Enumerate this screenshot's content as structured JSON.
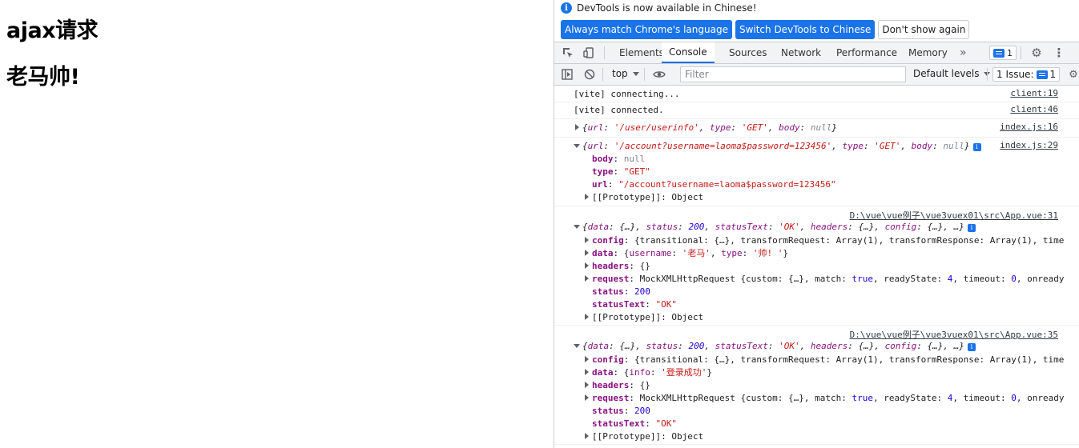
{
  "page": {
    "heading1": "ajax请求",
    "heading2": "老马帅!"
  },
  "devtools": {
    "infobar": {
      "message": "DevTools is now available in Chinese!",
      "buttons": [
        "Always match Chrome's language",
        "Switch DevTools to Chinese",
        "Don't show again"
      ]
    },
    "tabs": [
      "Elements",
      "Console",
      "Sources",
      "Network",
      "Performance",
      "Memory"
    ],
    "active_tab": "Console",
    "more_tabs_glyph": "»",
    "issues_count": "1",
    "toolbar": {
      "context": "top",
      "filter_placeholder": "Filter",
      "levels": "Default levels",
      "issue_label": "1 Issue:",
      "issue_count": "1"
    },
    "colors": {
      "accent": "#1a73e8"
    },
    "icons": [
      "inspect-icon",
      "device-icon",
      "settings-icon",
      "kebab-menu-icon",
      "sidebar-toggle-icon",
      "clear-icon",
      "eye-icon",
      "info-icon"
    ]
  },
  "console": {
    "msg1": {
      "text": "[vite] connecting...",
      "src": "client:19"
    },
    "msg2": {
      "text": "[vite] connected.",
      "src": "client:46"
    },
    "msg3": {
      "src": "index.js:16",
      "url": "'/user/userinfo'",
      "type": "'GET'",
      "body": "null"
    },
    "msg4": {
      "src": "index.js:29",
      "url": "'/account?username=laoma$password=123456'",
      "type": "'GET'",
      "body": "null",
      "props": {
        "body": "null",
        "type": "\"GET\"",
        "url": "\"/account?username=laoma$password=123456\"",
        "proto": "[[Prototype]]: Object"
      }
    },
    "msg5": {
      "src": "D:\\vue\\vue例子\\vue3vuex01\\src\\App.vue:31",
      "summary_status": "200",
      "summary_statusText": "'OK'",
      "config": "{transitional: {…}, transformRequest: Array(1), transformResponse: Array(1), time",
      "data_username": "'老马'",
      "data_type": "'帅! '",
      "headers": "{}",
      "request_prefix": "MockXMLHttpRequest {custom: {…}, match: ",
      "request_true": "true",
      "request_mid": ", readyState: ",
      "request_ready": "4",
      "request_mid2": ", timeout: ",
      "request_timeout": "0",
      "request_suffix": ", onready",
      "status": "200",
      "statusText": "\"OK\"",
      "proto": "[[Prototype]]: Object"
    },
    "msg6": {
      "src": "D:\\vue\\vue例子\\vue3vuex01\\src\\App.vue:35",
      "summary_status": "200",
      "summary_statusText": "'OK'",
      "config": "{transitional: {…}, transformRequest: Array(1), transformResponse: Array(1), time",
      "data_info": "'登录成功'",
      "headers": "{}",
      "request_prefix": "MockXMLHttpRequest {custom: {…}, match: ",
      "request_true": "true",
      "request_mid": ", readyState: ",
      "request_ready": "4",
      "request_mid2": ", timeout: ",
      "request_timeout": "0",
      "request_suffix": ", onready",
      "status": "200",
      "statusText": "\"OK\"",
      "proto": "[[Prototype]]: Object"
    }
  }
}
